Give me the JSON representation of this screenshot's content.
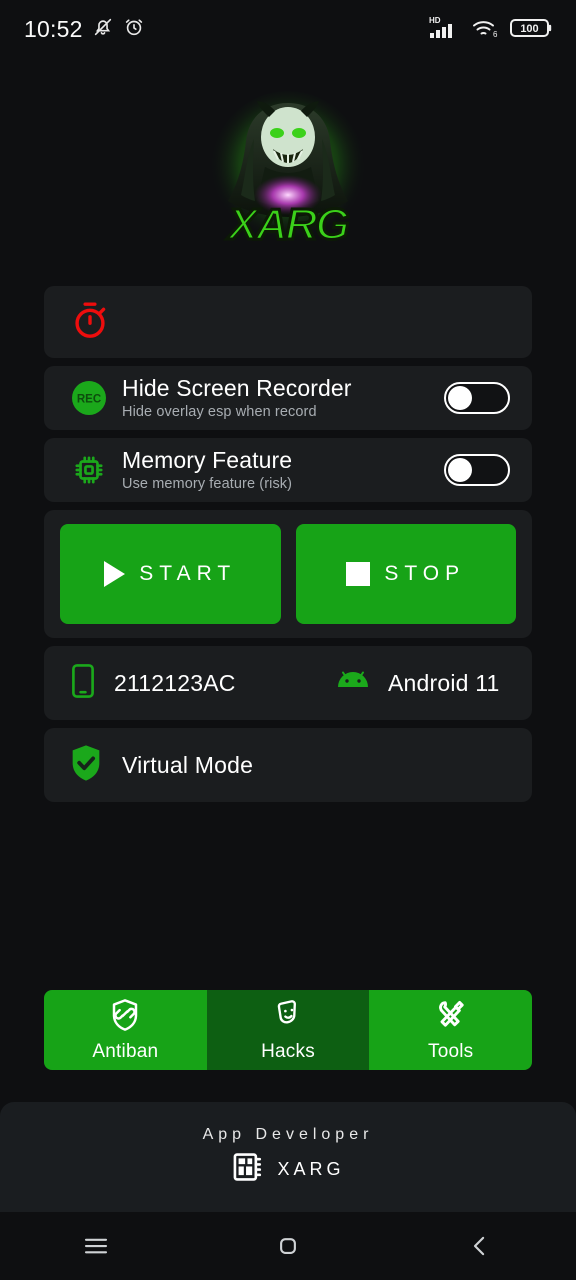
{
  "status_bar": {
    "time": "10:52",
    "icons_left": [
      "silent-bell-icon",
      "alarm-clock-icon"
    ],
    "icons_right": [
      "hd-signal-icon",
      "wifi-6-icon",
      "battery-icon"
    ],
    "hd_label": "HD",
    "wifi_generation": "6",
    "battery_level": "100"
  },
  "brand": {
    "logo_name": "xarg-predator-logo",
    "logo_text": "XARG",
    "accent_green": "#3bd11a",
    "glow_green": "#49ff1a"
  },
  "timer_card": {
    "icon": "stopwatch-icon",
    "icon_color": "#ee0d0d",
    "value": ""
  },
  "toggles": [
    {
      "icon": "rec-icon",
      "icon_text": "REC",
      "title": "Hide Screen Recorder",
      "subtitle": "Hide overlay esp when record",
      "state": "off"
    },
    {
      "icon": "cpu-chip-icon",
      "title": "Memory Feature",
      "subtitle": "Use memory feature (risk)",
      "state": "off"
    }
  ],
  "actions": {
    "start_label": "START",
    "stop_label": "STOP",
    "start_icon": "play-icon",
    "stop_icon": "stop-icon",
    "button_color": "#17a317"
  },
  "device_info": {
    "phone_icon": "smartphone-icon",
    "model": "2112123AC",
    "android_icon": "android-robot-icon",
    "os_version": "Android 11"
  },
  "virtual_mode": {
    "icon": "shield-check-icon",
    "label": "Virtual Mode"
  },
  "tabs": [
    {
      "label": "Antiban",
      "icon": "shield-link-icon",
      "color": "#17a317",
      "selected": false
    },
    {
      "label": "Hacks",
      "icon": "theater-masks-icon",
      "color": "#0d5f12",
      "selected": true
    },
    {
      "label": "Tools",
      "icon": "wrench-screwdriver-icon",
      "color": "#17a317",
      "selected": false
    }
  ],
  "footer": {
    "title": "App Developer",
    "icon": "memory-chip-icon",
    "developer": "XARG"
  },
  "nav_bar": {
    "recents_icon": "menu-icon",
    "home_icon": "home-square-icon",
    "back_icon": "back-chevron-icon"
  }
}
